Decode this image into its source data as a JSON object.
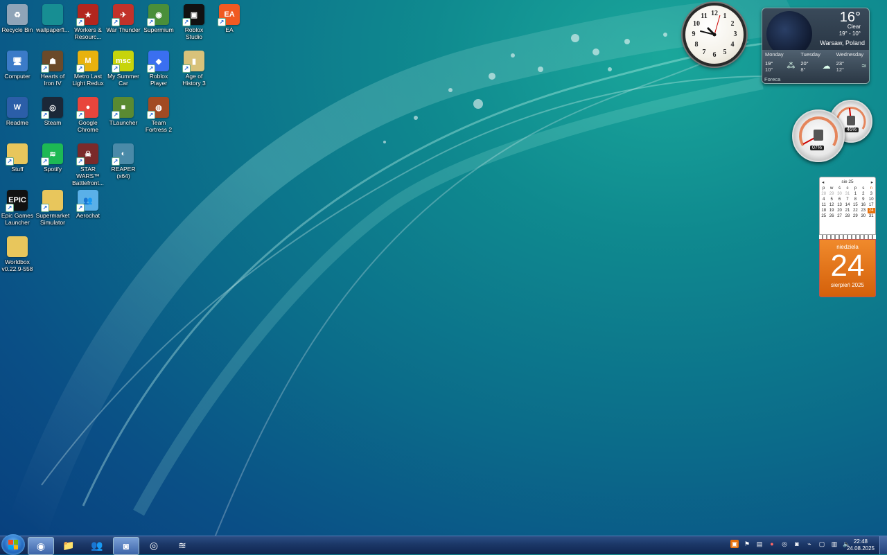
{
  "desktop_icons": [
    {
      "label": "Recycle Bin",
      "icon": "recycle-bin-icon",
      "color": "#8fa4b8",
      "glyph": "♻",
      "shortcut": false
    },
    {
      "label": "wallpaperfl...",
      "icon": "image-file-icon",
      "color": "#178e93",
      "glyph": "",
      "shortcut": false
    },
    {
      "label": "Workers & Resourc...",
      "icon": "workers-resources-icon",
      "color": "#b3261e",
      "glyph": "★",
      "shortcut": true
    },
    {
      "label": "War Thunder",
      "icon": "war-thunder-icon",
      "color": "#c2322a",
      "glyph": "✈",
      "shortcut": true
    },
    {
      "label": "Supermium",
      "icon": "supermium-icon",
      "color": "#4a8f3a",
      "glyph": "◉",
      "shortcut": true
    },
    {
      "label": "Roblox Studio",
      "icon": "roblox-studio-icon",
      "color": "#111111",
      "glyph": "▣",
      "shortcut": true
    },
    {
      "label": "EA",
      "icon": "ea-icon",
      "color": "#f05a22",
      "glyph": "EA",
      "shortcut": true
    },
    {
      "label": "Computer",
      "icon": "computer-icon",
      "color": "#3b7bc8",
      "glyph": "🖥",
      "shortcut": false
    },
    {
      "label": "Hearts of Iron IV",
      "icon": "hearts-of-iron-icon",
      "color": "#6b4a2a",
      "glyph": "☗",
      "shortcut": true
    },
    {
      "label": "Metro Last Light Redux",
      "icon": "metro-icon",
      "color": "#e8b20e",
      "glyph": "M",
      "shortcut": true
    },
    {
      "label": "My Summer Car",
      "icon": "my-summer-car-icon",
      "color": "#c7d40b",
      "glyph": "msc",
      "shortcut": true
    },
    {
      "label": "Roblox Player",
      "icon": "roblox-player-icon",
      "color": "#3a6ff0",
      "glyph": "◆",
      "shortcut": true
    },
    {
      "label": "Age of History 3",
      "icon": "age-of-history-icon",
      "color": "#d8c27a",
      "glyph": "▮",
      "shortcut": true
    },
    {
      "label": "Readme",
      "icon": "word-document-icon",
      "color": "#2b5ea8",
      "glyph": "W",
      "shortcut": false
    },
    {
      "label": "Steam",
      "icon": "steam-icon",
      "color": "#1b2838",
      "glyph": "◎",
      "shortcut": true
    },
    {
      "label": "Google Chrome",
      "icon": "chrome-icon",
      "color": "#e8453c",
      "glyph": "●",
      "shortcut": true
    },
    {
      "label": "TLauncher",
      "icon": "tlauncher-icon",
      "color": "#5a8a32",
      "glyph": "■",
      "shortcut": true
    },
    {
      "label": "Team Fortress 2",
      "icon": "team-fortress-icon",
      "color": "#a24a22",
      "glyph": "◍",
      "shortcut": true
    },
    {
      "label": "Stuff",
      "icon": "folder-icon",
      "color": "#e8c65c",
      "glyph": "",
      "shortcut": true
    },
    {
      "label": "Spotify",
      "icon": "spotify-icon",
      "color": "#1db954",
      "glyph": "≋",
      "shortcut": true
    },
    {
      "label": "STAR WARS™ Battlefront...",
      "icon": "star-wars-icon",
      "color": "#7a2a2a",
      "glyph": "☠",
      "shortcut": true
    },
    {
      "label": "REAPER (x64)",
      "icon": "reaper-icon",
      "color": "#4a8aa8",
      "glyph": "◐",
      "shortcut": true
    },
    {
      "label": "Epic Games Launcher",
      "icon": "epic-games-icon",
      "color": "#111111",
      "glyph": "EPIC",
      "shortcut": true
    },
    {
      "label": "Supermarket Simulator",
      "icon": "folder-icon",
      "color": "#e8c65c",
      "glyph": "",
      "shortcut": true
    },
    {
      "label": "Aerochat",
      "icon": "aerochat-icon",
      "color": "#5ab0e8",
      "glyph": "👥",
      "shortcut": true
    },
    {
      "label": "Worldbox v0.22.9-558",
      "icon": "folder-icon",
      "color": "#e8c65c",
      "glyph": "",
      "shortcut": false
    }
  ],
  "clock": {
    "numbers": [
      "12",
      "1",
      "2",
      "3",
      "4",
      "5",
      "6",
      "7",
      "8",
      "9",
      "10",
      "11"
    ]
  },
  "weather": {
    "temp": "16°",
    "condition": "Clear",
    "range": "19° - 10°",
    "city": "Warsaw, Poland",
    "provider": "Foreca",
    "forecast": [
      {
        "day": "Monday",
        "hi": "19°",
        "lo": "10°",
        "icon": "rain-icon"
      },
      {
        "day": "Tuesday",
        "hi": "20°",
        "lo": "8°",
        "icon": "cloud-icon"
      },
      {
        "day": "Wednesday",
        "hi": "23°",
        "lo": "12°",
        "icon": "wind-icon"
      }
    ]
  },
  "meters": {
    "cpu": "07%",
    "ram": "46%"
  },
  "calendar": {
    "month_label": "sie 25",
    "weekday_headers": [
      "p",
      "w",
      "ś",
      "c",
      "p",
      "s",
      "n"
    ],
    "rows": [
      [
        "28",
        "29",
        "30",
        "31",
        "1",
        "2",
        "3"
      ],
      [
        "4",
        "5",
        "6",
        "7",
        "8",
        "9",
        "10"
      ],
      [
        "11",
        "12",
        "13",
        "14",
        "15",
        "16",
        "17"
      ],
      [
        "18",
        "19",
        "20",
        "21",
        "22",
        "23",
        "24"
      ],
      [
        "25",
        "26",
        "27",
        "28",
        "29",
        "30",
        "31"
      ]
    ],
    "weekday": "niedziela",
    "day": "24",
    "month_year": "sierpień 2025"
  },
  "taskbar": {
    "buttons": [
      {
        "name": "supermium",
        "glyph": "◉",
        "active": true
      },
      {
        "name": "file-explorer",
        "glyph": "📁",
        "active": false
      },
      {
        "name": "aerochat",
        "glyph": "👥",
        "active": false
      },
      {
        "name": "discord",
        "glyph": "◙",
        "active": true
      },
      {
        "name": "steam",
        "glyph": "◎",
        "active": false
      },
      {
        "name": "spotify",
        "glyph": "≋",
        "active": false
      }
    ],
    "time": "22:48",
    "date": "24.08.2025"
  }
}
